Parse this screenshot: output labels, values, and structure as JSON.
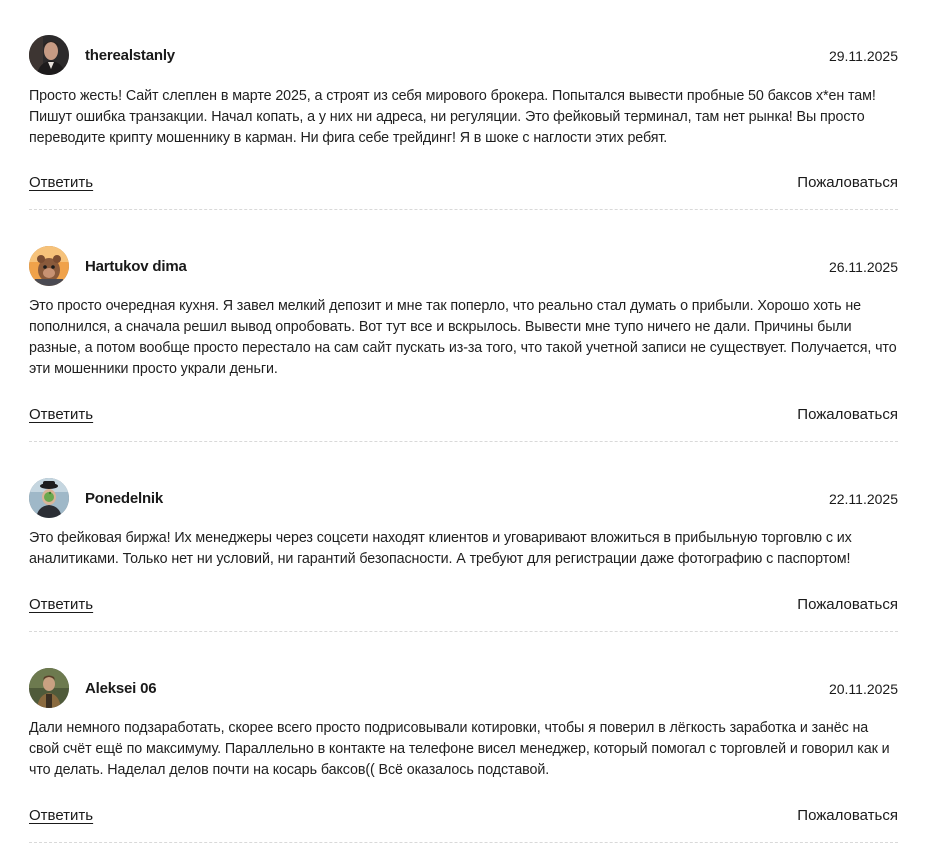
{
  "comments": [
    {
      "author": "therealstanly",
      "date": "29.11.2025",
      "text": "Просто жесть! Сайт слеплен в марте 2025, а строят из себя мирового брокера. Попытался вывести пробные 50 баксов х*ен там! Пишут ошибка транзакции. Начал копать, а у них ни адреса, ни регуляции. Это фейковый терминал, там нет рынка! Вы просто переводите крипту мошеннику в карман. Ни фига себе трейдинг! Я в шоке с наглости этих ребят.",
      "reply_label": "Ответить",
      "report_label": "Пожаловаться"
    },
    {
      "author": "Hartukov dima",
      "date": "26.11.2025",
      "text": "Это просто очередная кухня. Я завел мелкий депозит и мне так поперло, что реально стал думать о прибыли. Хорошо хоть не пополнился, а сначала решил вывод опробовать. Вот тут все и вскрылось. Вывести мне тупо ничего не дали. Причины были разные, а потом вообще просто перестало на сам сайт пускать из-за того, что такой учетной записи не существует. Получается, что эти мошенники просто украли деньги.",
      "reply_label": "Ответить",
      "report_label": "Пожаловаться"
    },
    {
      "author": "Ponedelnik",
      "date": "22.11.2025",
      "text": "Это фейковая биржа! Их менеджеры через соцсети находят клиентов и уговаривают вложиться в прибыльную торговлю с их аналитиками. Только нет ни условий, ни гарантий безопасности. А требуют для регистрации даже фотографию с паспортом!",
      "reply_label": "Ответить",
      "report_label": "Пожаловаться"
    },
    {
      "author": "Aleksei 06",
      "date": "20.11.2025",
      "text": "Дали немного подзаработать, скорее всего просто подрисовывали котировки, чтобы я поверил в лёгкость заработка и занёс на свой счёт ещё по максимуму. Параллельно в контакте на телефоне висел менеджер, который помогал с торговлей и говорил как и что делать. Наделал делов почти на косарь баксов(( Всё оказалось подставой.",
      "reply_label": "Ответить",
      "report_label": "Пожаловаться"
    }
  ]
}
